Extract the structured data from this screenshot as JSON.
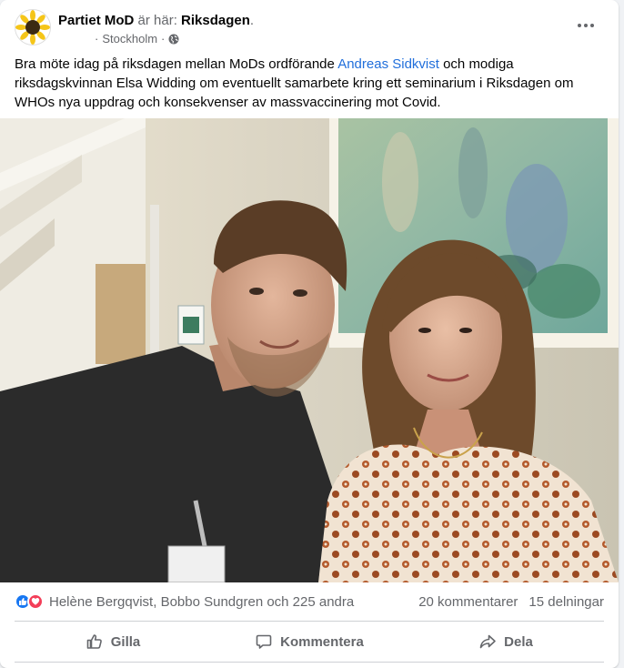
{
  "post": {
    "author": "Partiet MoD",
    "at_text": "är här:",
    "place": "Riksdagen",
    "place_suffix": ".",
    "location": "Stockholm",
    "text_before": "Bra möte idag på riksdagen mellan MoDs ordförande ",
    "mention": "Andreas Sidkvist",
    "text_after": " och modiga riksdagskvinnan Elsa Widding om eventuellt samarbete kring ett seminarium i Riksdagen om WHOs nya uppdrag och konsekvenser av massvaccinering mot Covid."
  },
  "stats": {
    "reactions_text": "Helène Bergqvist, Bobbo Sundgren och 225 andra",
    "comments": "20 kommentarer",
    "shares": "15 delningar"
  },
  "actions": {
    "like": "Gilla",
    "comment": "Kommentera",
    "share": "Dela"
  },
  "colors": {
    "link": "#216fdb",
    "like": "#1877f2",
    "love": "#f33e58",
    "muted": "#65676b"
  },
  "icons": [
    "sunflower-logo-icon",
    "globe-icon",
    "more-options-icon",
    "like-reaction-icon",
    "love-reaction-icon",
    "thumbs-up-icon",
    "comment-icon",
    "share-icon"
  ]
}
